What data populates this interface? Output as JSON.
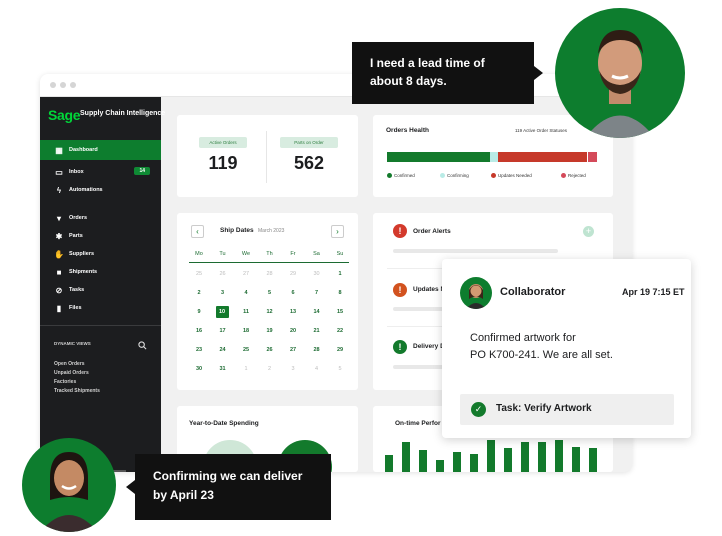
{
  "sidebar": {
    "logo": "Sage",
    "title": "Supply Chain Intelligence",
    "items": [
      {
        "label": "Dashboard",
        "icon": "dashboard-icon"
      },
      {
        "label": "Inbox",
        "icon": "inbox-icon",
        "badge": "14"
      },
      {
        "label": "Automations",
        "icon": "lightning-icon"
      },
      {
        "label": "Orders",
        "icon": "cart-icon"
      },
      {
        "label": "Parts",
        "icon": "parts-icon"
      },
      {
        "label": "Suppliers",
        "icon": "handshake-icon"
      },
      {
        "label": "Shipments",
        "icon": "truck-icon"
      },
      {
        "label": "Tasks",
        "icon": "check-circle-icon"
      },
      {
        "label": "Files",
        "icon": "file-icon"
      }
    ],
    "dynamic_views_label": "DYNAMIC VIEWS",
    "dynamic_views": [
      "Open Orders",
      "Unpaid Orders",
      "Factories",
      "Tracked Shipments"
    ]
  },
  "kpis": {
    "active_orders_label": "Active Orders",
    "active_orders_value": "119",
    "parts_on_order_label": "Parts on Order",
    "parts_on_order_value": "562"
  },
  "orders_health": {
    "title": "Orders Health",
    "subtitle": "119 Active Order Statuses",
    "legend": [
      "Confirmed",
      "Confirming",
      "Updates Needed",
      "Rejected"
    ],
    "colors": {
      "confirmed": "#137a2c",
      "confirming": "#b9ebe6",
      "updates_needed": "#c6392a",
      "rejected": "#d44a5a"
    }
  },
  "calendar": {
    "title": "Ship Dates",
    "month": "March 2023",
    "weekdays": [
      "Mo",
      "Tu",
      "We",
      "Th",
      "Fr",
      "Sa",
      "Su"
    ],
    "weeks": [
      [
        "25",
        "26",
        "27",
        "28",
        "29",
        "30",
        "1"
      ],
      [
        "2",
        "3",
        "4",
        "5",
        "6",
        "7",
        "8"
      ],
      [
        "9",
        "10",
        "11",
        "12",
        "13",
        "14",
        "15"
      ],
      [
        "16",
        "17",
        "18",
        "19",
        "20",
        "21",
        "22"
      ],
      [
        "23",
        "24",
        "25",
        "26",
        "27",
        "28",
        "29"
      ],
      [
        "30",
        "31",
        "1",
        "2",
        "3",
        "4",
        "5"
      ]
    ],
    "selected": "10"
  },
  "order_alerts": {
    "title": "Order Alerts",
    "rows": [
      "Updates N",
      "Delivery D"
    ]
  },
  "spending": {
    "title": "Year-to-Date Spending"
  },
  "ontime": {
    "title": "On-time Perfor",
    "bars": [
      0.55,
      0.95,
      0.7,
      0.4,
      0.65,
      0.6,
      1.0,
      0.75,
      0.95,
      0.95,
      1.0,
      0.8,
      0.75
    ]
  },
  "collaborator": {
    "name": "Collaborator",
    "time": "Apr 19 7:15 ET",
    "message_line1": "Confirmed artwork for",
    "message_line2": "PO K700-241. We are all set.",
    "task": "Task: Verify Artwork"
  },
  "bubble_top": {
    "line1": "I need a lead time of",
    "line2": "about 8 days."
  },
  "bubble_bottom": {
    "line1": "Confirming we can deliver",
    "line2": "by April 23"
  }
}
